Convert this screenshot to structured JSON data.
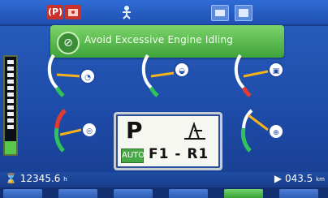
{
  "topbar": {
    "icons": [
      {
        "name": "parking-brake-icon",
        "label": "(P)",
        "color": "#e0392d"
      },
      {
        "name": "engine-warning-icon",
        "label": "",
        "color": "#e0392d"
      },
      {
        "name": "person-icon",
        "label": "",
        "color": "#6aa0f0"
      },
      {
        "name": "camera-icon",
        "label": "",
        "color": "#6aa0f0"
      },
      {
        "name": "screen-icon",
        "label": "",
        "color": "#6aa0f0"
      }
    ]
  },
  "alert": {
    "text": "Avoid Excessive Engine Idling",
    "icon": "no-idle-icon",
    "color": "#4fb545"
  },
  "transmission": {
    "gear": "P",
    "mode": "AUTO",
    "range": "F1 - R1"
  },
  "status": {
    "hour_meter": "12345.6",
    "hour_unit": "h",
    "odometer": "043.5",
    "odo_unit": "km"
  },
  "gauges": [
    {
      "name": "engine-coolant-gauge",
      "icon": "coolant-temp-icon",
      "level": 0.35
    },
    {
      "name": "hydraulic-oil-gauge",
      "icon": "oil-temp-icon",
      "level": 0.3
    },
    {
      "name": "fuel-level-gauge",
      "icon": "fuel-icon",
      "level": 0.7
    },
    {
      "name": "transmission-temp-gauge",
      "icon": "transmission-temp-icon",
      "level": 0.25
    },
    {
      "name": "def-level-gauge",
      "icon": "def-icon",
      "level": 0.65
    }
  ],
  "softkeys": [
    "",
    "",
    "",
    "",
    "",
    ""
  ]
}
